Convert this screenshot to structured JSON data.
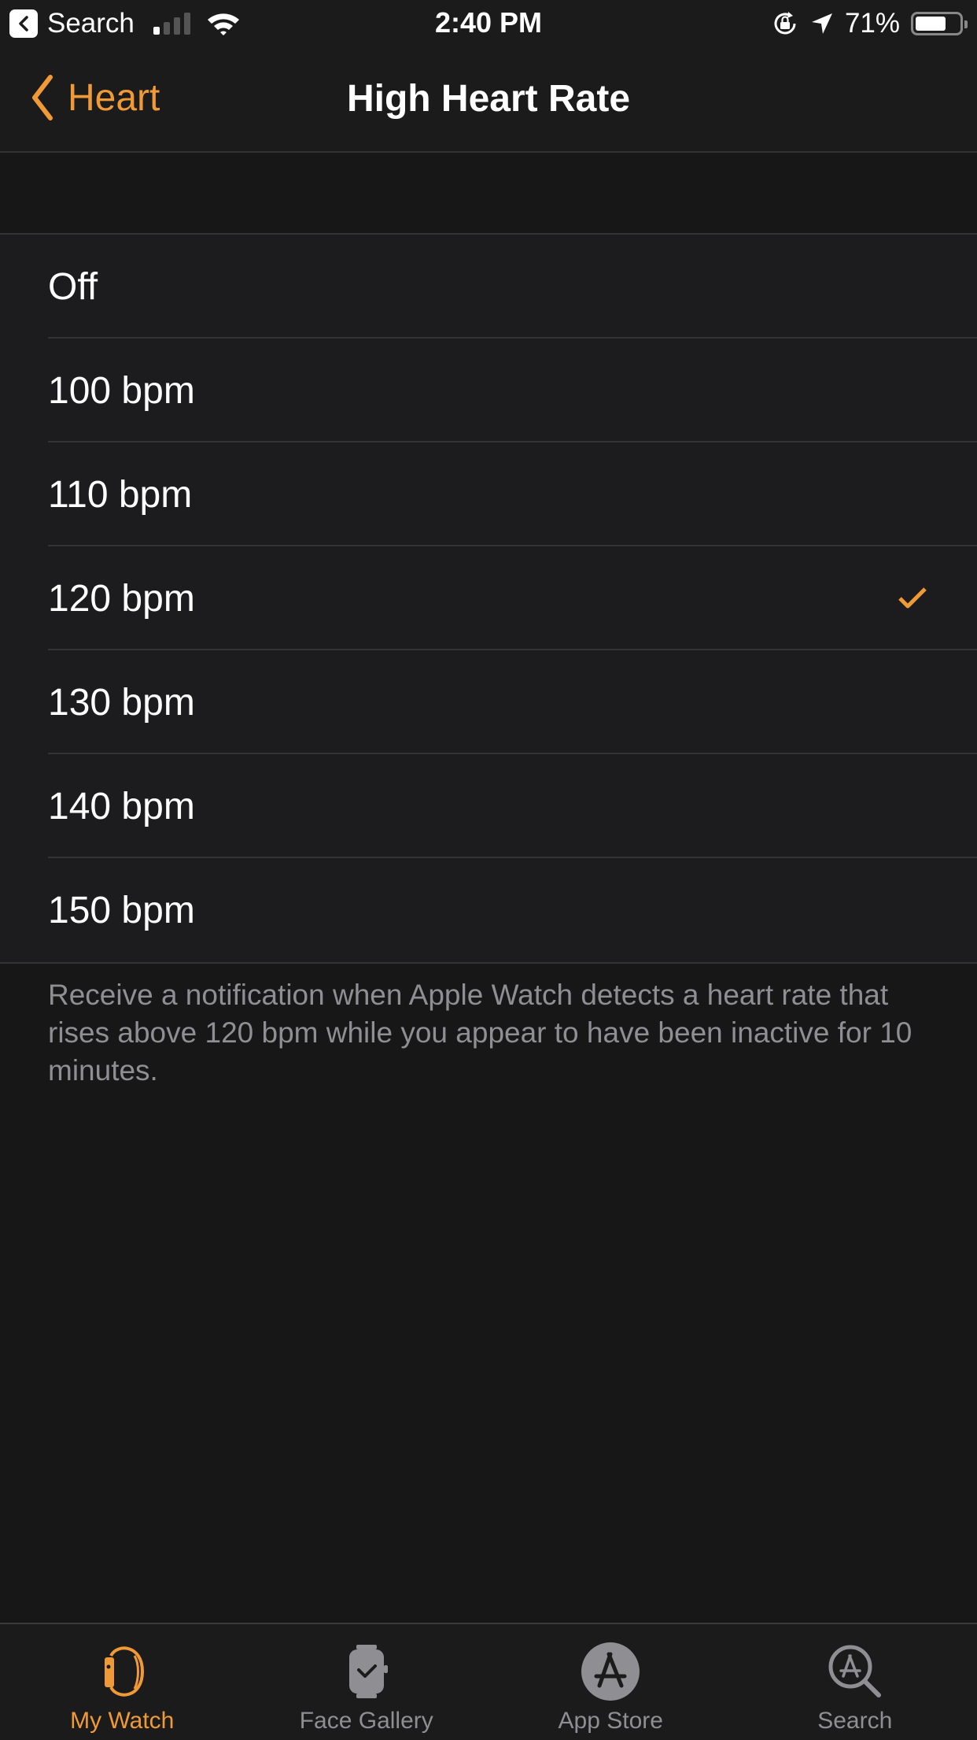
{
  "status_bar": {
    "back_app_label": "Search",
    "time": "2:40 PM",
    "battery_percent_text": "71%",
    "battery_level": 0.71,
    "signal_bars_active": 1,
    "signal_bars_total": 4,
    "icons": [
      "back-app-icon",
      "signal-icon",
      "wifi-icon",
      "rotation-lock-icon",
      "location-icon",
      "battery-icon"
    ]
  },
  "nav": {
    "back_label": "Heart",
    "title": "High Heart Rate"
  },
  "options": [
    {
      "label": "Off",
      "selected": false
    },
    {
      "label": "100 bpm",
      "selected": false
    },
    {
      "label": "110 bpm",
      "selected": false
    },
    {
      "label": "120 bpm",
      "selected": true
    },
    {
      "label": "130 bpm",
      "selected": false
    },
    {
      "label": "140 bpm",
      "selected": false
    },
    {
      "label": "150 bpm",
      "selected": false
    }
  ],
  "footnote": "Receive a notification when Apple Watch detects a heart rate that rises above 120 bpm while you appear to have been inactive for 10 minutes.",
  "tabs": [
    {
      "label": "My Watch",
      "icon": "my-watch-icon",
      "active": true
    },
    {
      "label": "Face Gallery",
      "icon": "face-gallery-icon",
      "active": false
    },
    {
      "label": "App Store",
      "icon": "app-store-icon",
      "active": false
    },
    {
      "label": "Search",
      "icon": "search-icon",
      "active": false
    }
  ],
  "colors": {
    "accent": "#f09a37",
    "background": "#171717",
    "cell_background": "#1c1c1e",
    "secondary_text": "#8e8e93"
  }
}
